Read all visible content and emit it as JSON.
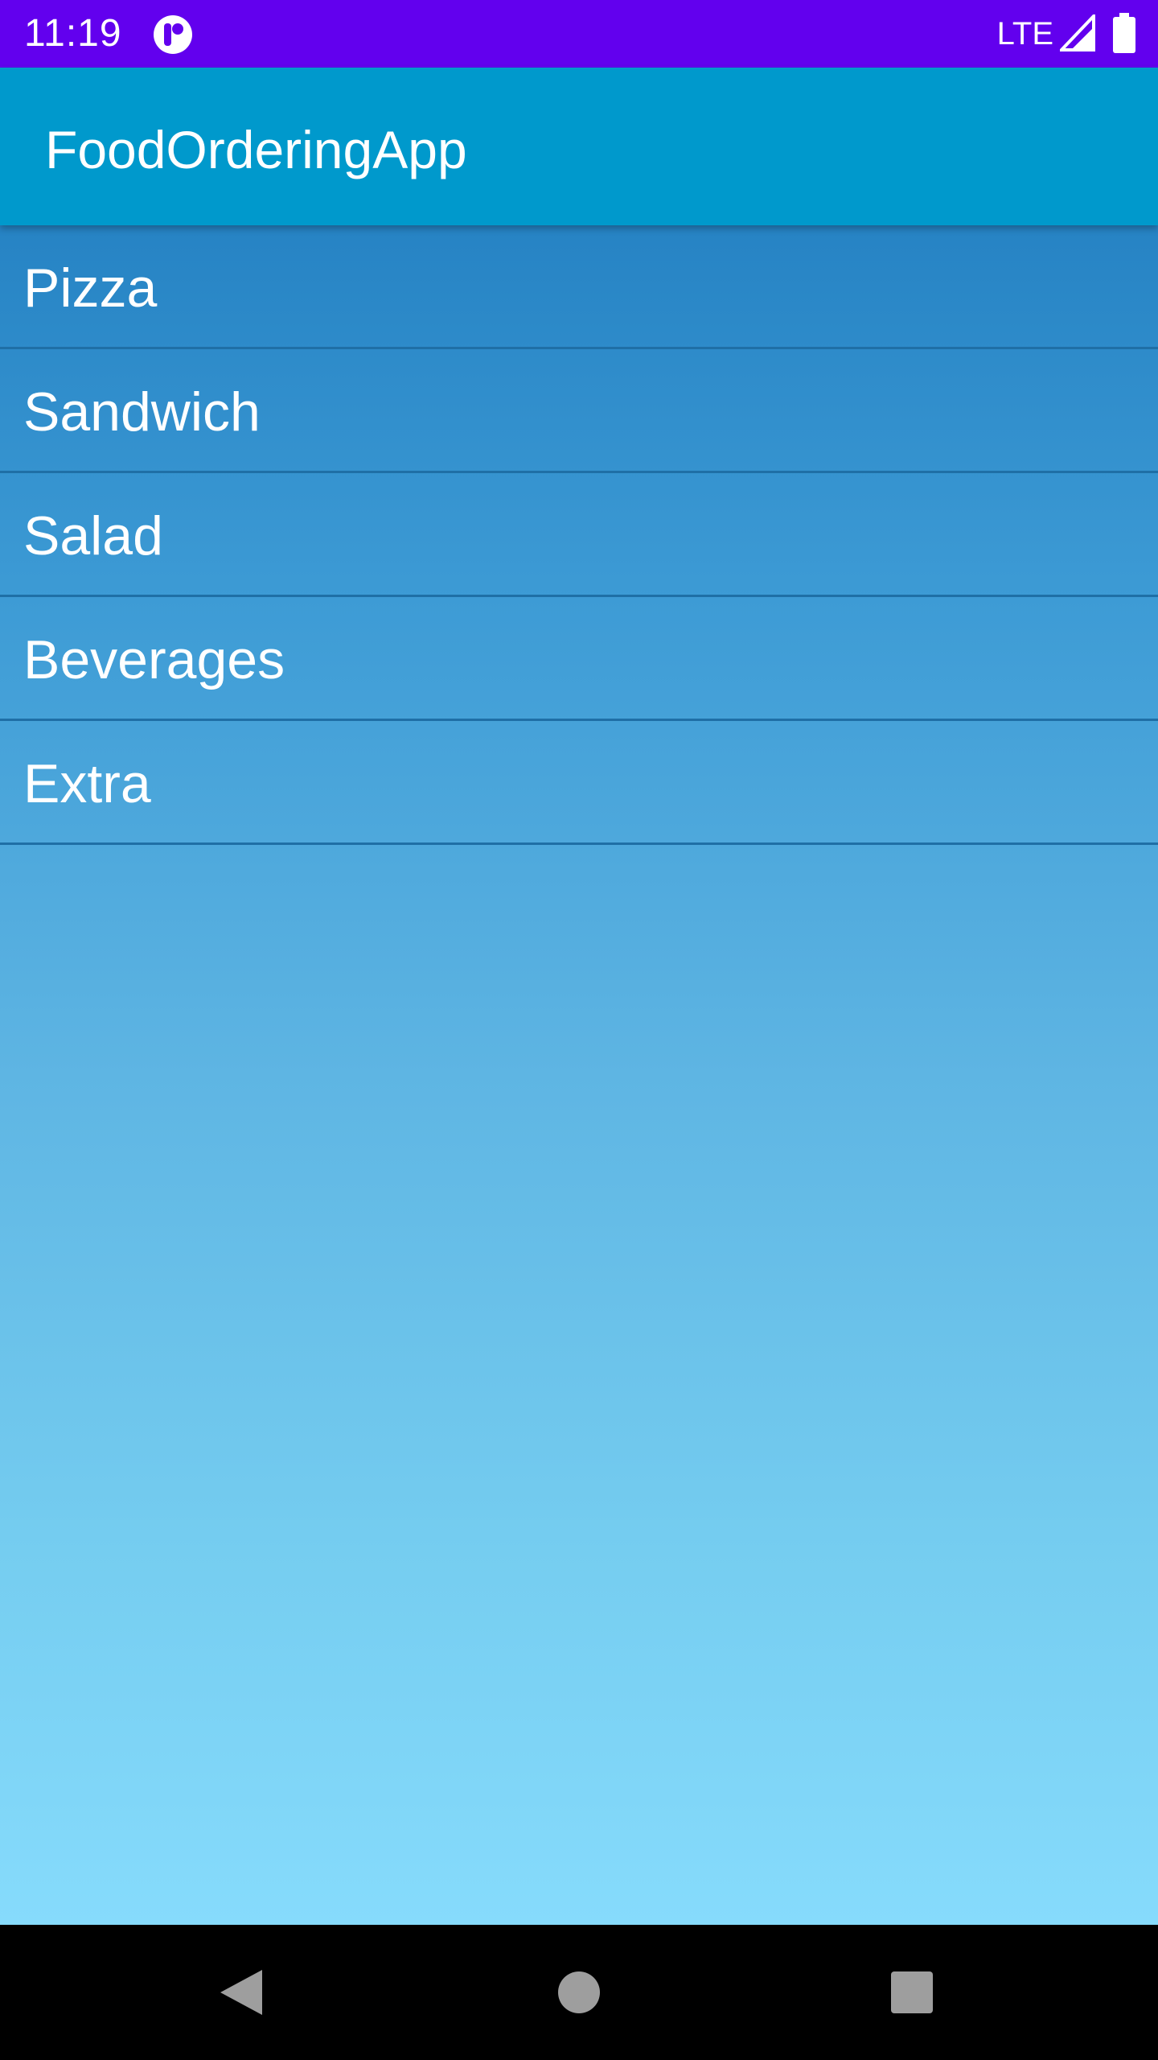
{
  "status_bar": {
    "time": "11:19",
    "network": "LTE",
    "app_icon": "notification-app-icon",
    "signal_icon": "signal-icon",
    "battery_icon": "battery-icon",
    "background_color": "#6200EE"
  },
  "app_bar": {
    "title": "FoodOrderingApp",
    "background_color": "#0099CC"
  },
  "menu": {
    "items": [
      {
        "label": "Pizza"
      },
      {
        "label": "Sandwich"
      },
      {
        "label": "Salad"
      },
      {
        "label": "Beverages"
      },
      {
        "label": "Extra"
      }
    ]
  },
  "nav_bar": {
    "back_icon": "back-triangle-icon",
    "home_icon": "home-circle-icon",
    "recents_icon": "recents-square-icon"
  }
}
